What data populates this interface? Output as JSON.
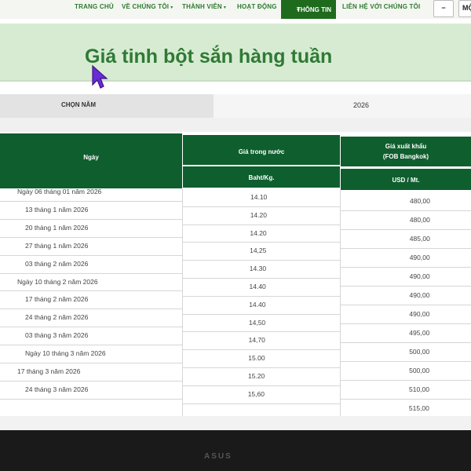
{
  "nav": {
    "items": [
      {
        "label": "TRANG CHỦ",
        "dropdown": false
      },
      {
        "label": "VỀ CHÚNG TÔI",
        "dropdown": true
      },
      {
        "label": "THÀNH VIÊN",
        "dropdown": true
      },
      {
        "label": "HOẠT ĐỘNG",
        "dropdown": false
      },
      {
        "label": "THÔNG TIN",
        "dropdown": true
      },
      {
        "label": "LIÊN HỆ VỚI CHÚNG TÔI",
        "dropdown": false
      }
    ],
    "dropdown_symbol": "▾",
    "minimize_label": "−",
    "partial_label": "MỘ"
  },
  "page": {
    "title": "Giá tinh bột sắn hàng tuần"
  },
  "year_filter": {
    "label": "CHỌN NĂM",
    "value": "2026"
  },
  "table": {
    "header": {
      "date": "Ngày",
      "domestic": "Giá trong nước",
      "export_line1": "Giá xuất khẩu",
      "export_line2": "(FOB Bangkok)",
      "domestic_unit": "Baht/Kg.",
      "export_unit": "USD / Mt."
    },
    "dates": [
      "Ngày 06 tháng 01 năm 2026",
      "13 tháng 1 năm 2026",
      "20 tháng 1 năm 2026",
      "27 tháng 1 năm 2026",
      "03 tháng 2 năm 2026",
      "Ngày 10 tháng 2 năm 2026",
      "17 tháng 2 năm 2026",
      "24 tháng 2 năm 2026",
      "03 tháng 3 năm 2026",
      "Ngày 10 tháng 3 năm 2026",
      "17 tháng 3 năm 2026",
      "24 tháng 3 năm 2026"
    ],
    "domestic_prices": [
      "14.10",
      "14.20",
      "14.20",
      "14,25",
      "14.30",
      "14.40",
      "14.40",
      "14,50",
      "14,70",
      "15.00",
      "15.20",
      "15,60"
    ],
    "export_prices": [
      "480,00",
      "480,00",
      "485,00",
      "490,00",
      "490,00",
      "490,00",
      "490,00",
      "495,00",
      "500,00",
      "500,00",
      "510,00",
      "515,00"
    ]
  },
  "bezel": {
    "logo": "ASUS"
  }
}
